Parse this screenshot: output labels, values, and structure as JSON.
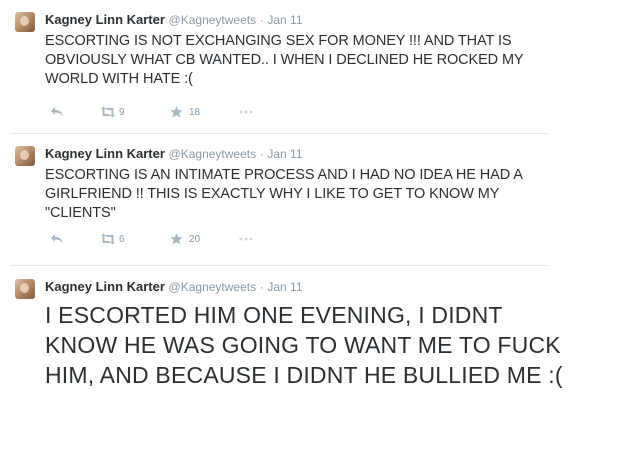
{
  "tweets": [
    {
      "name": "Kagney Linn Karter",
      "handle": "@Kagneytweets",
      "separator": "·",
      "date": "Jan 11",
      "text": "ESCORTING IS NOT EXCHANGING SEX FOR MONEY !!! AND THAT IS OBVIOUSLY WHAT CB WANTED.. I WHEN I DECLINED HE ROCKED MY WORLD WITH HATE :(",
      "retweets": "9",
      "favorites": "18"
    },
    {
      "name": "Kagney Linn Karter",
      "handle": "@Kagneytweets",
      "separator": "·",
      "date": "Jan 11",
      "text": "ESCORTING IS AN INTIMATE PROCESS AND I HAD NO IDEA HE HAD A GIRLFRIEND !! THIS IS EXACTLY WHY I LIKE TO GET TO KNOW MY \"CLIENTS\"",
      "retweets": "6",
      "favorites": "20"
    },
    {
      "name": "Kagney Linn Karter",
      "handle": "@Kagneytweets",
      "separator": "·",
      "date": "Jan 11",
      "text": "I ESCORTED HIM ONE EVENING, I DIDNT KNOW HE WAS GOING TO WANT ME TO FUCK HIM, AND BECAUSE I DIDNT HE BULLIED ME :("
    }
  ],
  "icons": {
    "reply": "reply-icon",
    "retweet": "retweet-icon",
    "favorite": "star-icon",
    "more": "more-icon"
  },
  "colors": {
    "text": "#292f33",
    "muted": "#8899a6",
    "divider": "#e1e8ed",
    "icon": "#aab8c2"
  }
}
